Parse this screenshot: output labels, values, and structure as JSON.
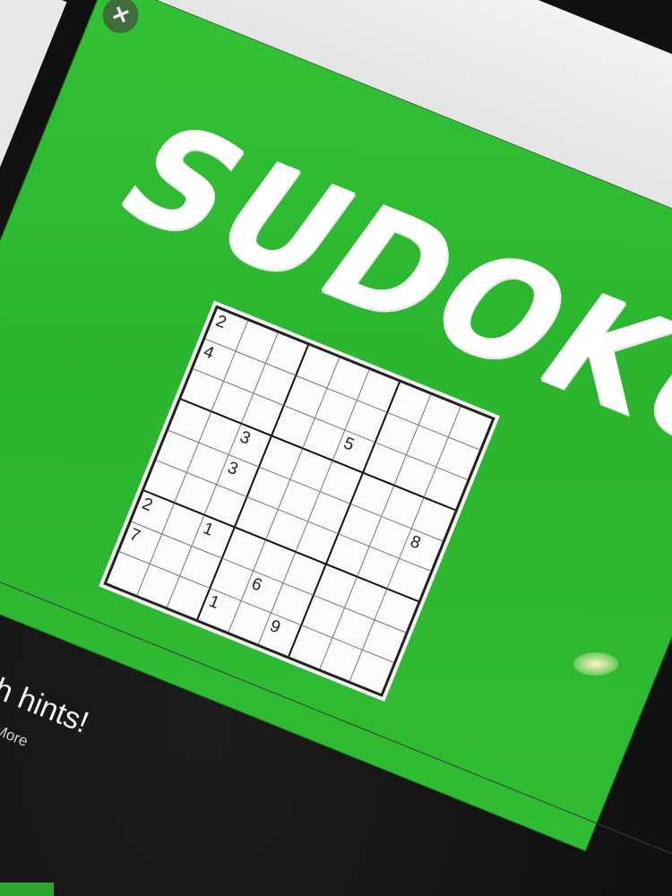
{
  "browser": {
    "reload_icon": "reload-icon"
  },
  "game": {
    "close_symbol": "×",
    "title": "SUDOKU",
    "accent_color": "#2db830",
    "grid": [
      [
        "2",
        "",
        "",
        "",
        "",
        "",
        "",
        "",
        ""
      ],
      [
        "4",
        "",
        "",
        "",
        "",
        "",
        "",
        "",
        ""
      ],
      [
        "",
        "",
        "",
        "",
        "",
        "5",
        "",
        "",
        ""
      ],
      [
        "",
        "",
        "3",
        "",
        "",
        "",
        "",
        "",
        ""
      ],
      [
        "",
        "",
        "3",
        "",
        "",
        "",
        "",
        "",
        "8"
      ],
      [
        "",
        "",
        "",
        "",
        "",
        "",
        "",
        "",
        ""
      ],
      [
        "2",
        "",
        "1",
        "",
        "",
        "",
        "",
        "",
        ""
      ],
      [
        "7",
        "",
        "",
        "",
        "6",
        "",
        "",
        "",
        ""
      ],
      [
        "",
        "",
        "",
        "",
        "",
        "9",
        "",
        "",
        ""
      ]
    ],
    "extra_grid_values": [
      "1"
    ]
  },
  "caption": {
    "tagline": "nline, with hints!",
    "fineprint": "pyright. Learn More"
  }
}
